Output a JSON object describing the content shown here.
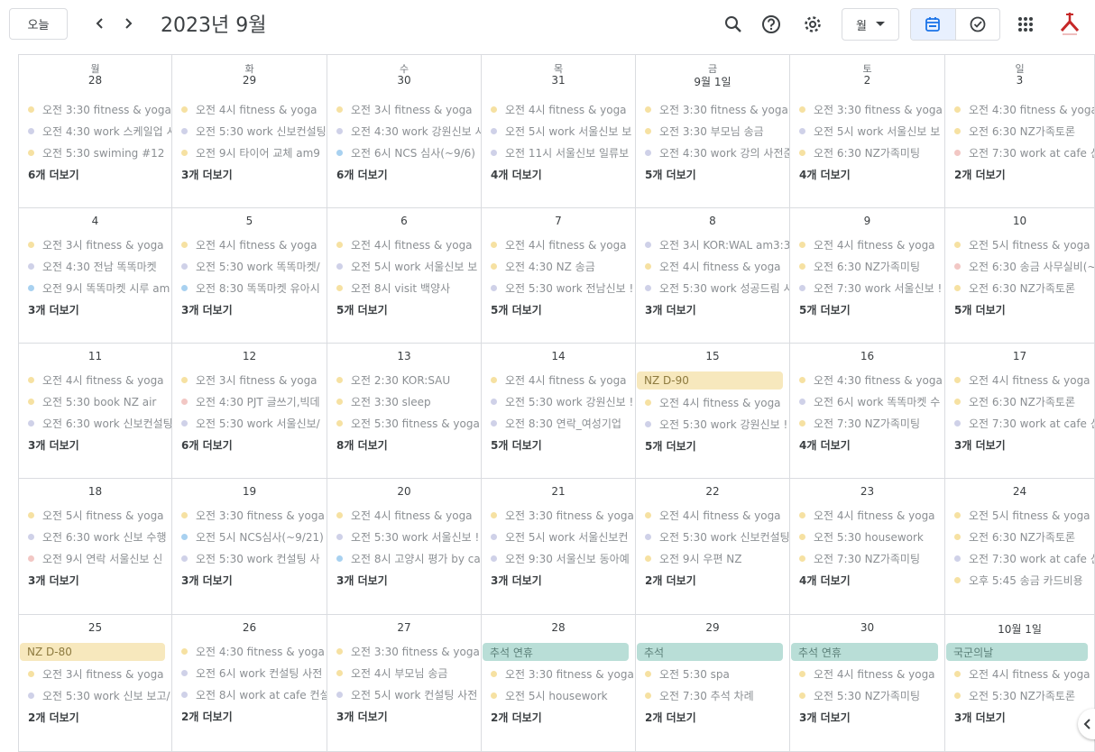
{
  "header": {
    "today_label": "오늘",
    "title": "2023년 9월",
    "view_label": "월"
  },
  "icons": [
    "chevron-left-icon",
    "chevron-right-icon",
    "search-icon",
    "help-icon",
    "gear-icon",
    "dropdown-arrow-icon",
    "calendar-icon",
    "tasks-icon",
    "apps-grid-icon",
    "logo"
  ],
  "colors": {
    "yellow": "#f6e1a2",
    "lavender": "#cfd1e8",
    "blue": "#a8d1f0",
    "pink": "#f2c7c4",
    "holiday": "#b9ded7",
    "nz_banner": "#f7e8bd"
  },
  "weekdays": [
    "월",
    "화",
    "수",
    "목",
    "금",
    "토",
    "일"
  ],
  "weeks": [
    [
      {
        "day": "28",
        "events": [
          {
            "t": "오전 3:30 fitness & yoga",
            "c": "yellow"
          },
          {
            "t": "오전 4:30 work 스케일업 시",
            "c": "lavender"
          },
          {
            "t": "오전 5:30 swiming #12",
            "c": "yellow"
          }
        ],
        "more": "6개 더보기"
      },
      {
        "day": "29",
        "events": [
          {
            "t": "오전 4시 fitness & yoga",
            "c": "yellow"
          },
          {
            "t": "오전 5:30 work 신보컨설팅",
            "c": "lavender"
          },
          {
            "t": "오전 9시 타이어 교체 am9",
            "c": "yellow"
          }
        ],
        "more": "3개 더보기"
      },
      {
        "day": "30",
        "events": [
          {
            "t": "오전 3시 fitness & yoga",
            "c": "yellow"
          },
          {
            "t": "오전 4:30 work 강원신보 시",
            "c": "lavender"
          },
          {
            "t": "오전 6시 NCS 심사(~9/6)",
            "c": "blue"
          }
        ],
        "more": "6개 더보기"
      },
      {
        "day": "31",
        "events": [
          {
            "t": "오전 4시 fitness & yoga",
            "c": "yellow"
          },
          {
            "t": "오전 5시 work 서울신보 보",
            "c": "lavender"
          },
          {
            "t": "오전 11시 서울신보 일류보",
            "c": "lavender"
          }
        ],
        "more": "4개 더보기"
      },
      {
        "day": "9월 1일",
        "events": [
          {
            "t": "오전 3:30 fitness & yoga",
            "c": "yellow"
          },
          {
            "t": "오전 3:30 부모님 송금",
            "c": "yellow"
          },
          {
            "t": "오전 4:30 work 강의 사전준",
            "c": "lavender"
          }
        ],
        "more": "5개 더보기"
      },
      {
        "day": "2",
        "events": [
          {
            "t": "오전 3:30 fitness & yoga",
            "c": "yellow"
          },
          {
            "t": "오전 5시 work 서울신보 보",
            "c": "lavender"
          },
          {
            "t": "오전 6:30 NZ가족미팅",
            "c": "yellow"
          }
        ],
        "more": "4개 더보기"
      },
      {
        "day": "3",
        "events": [
          {
            "t": "오전 4:30 fitness & yoga",
            "c": "yellow"
          },
          {
            "t": "오전 6:30 NZ가족토론",
            "c": "yellow"
          },
          {
            "t": "오전 7:30 work at cafe 신",
            "c": "pink"
          }
        ],
        "more": "2개 더보기"
      }
    ],
    [
      {
        "day": "4",
        "events": [
          {
            "t": "오전 3시 fitness & yoga",
            "c": "yellow"
          },
          {
            "t": "오전 4:30 전남 똑똑마켓",
            "c": "lavender"
          },
          {
            "t": "오전 9시 똑똑마켓 시루 am",
            "c": "blue"
          }
        ],
        "more": "3개 더보기"
      },
      {
        "day": "5",
        "events": [
          {
            "t": "오전 4시 fitness & yoga",
            "c": "yellow"
          },
          {
            "t": "오전 5:30 work 똑똑마켓/",
            "c": "lavender"
          },
          {
            "t": "오전 8:30 똑똑마켓 유아시",
            "c": "blue"
          }
        ],
        "more": "3개 더보기"
      },
      {
        "day": "6",
        "events": [
          {
            "t": "오전 4시 fitness & yoga",
            "c": "yellow"
          },
          {
            "t": "오전 5시 work 서울신보 보",
            "c": "lavender"
          },
          {
            "t": "오전 8시 visit 백양사",
            "c": "yellow"
          }
        ],
        "more": "5개 더보기"
      },
      {
        "day": "7",
        "events": [
          {
            "t": "오전 4시 fitness & yoga",
            "c": "yellow"
          },
          {
            "t": "오전 4:30 NZ 송금",
            "c": "yellow"
          },
          {
            "t": "오전 5:30 work 전남신보 !",
            "c": "lavender"
          }
        ],
        "more": "5개 더보기"
      },
      {
        "day": "8",
        "events": [
          {
            "t": "오전 3시 KOR:WAL am3:3",
            "c": "lavender"
          },
          {
            "t": "오전 4시 fitness & yoga",
            "c": "yellow"
          },
          {
            "t": "오전 5:30 work 성공드림 시",
            "c": "lavender"
          }
        ],
        "more": "3개 더보기"
      },
      {
        "day": "9",
        "events": [
          {
            "t": "오전 4시 fitness & yoga",
            "c": "yellow"
          },
          {
            "t": "오전 6:30 NZ가족미팅",
            "c": "yellow"
          },
          {
            "t": "오전 7:30 work 서울신보 !",
            "c": "lavender"
          }
        ],
        "more": "5개 더보기"
      },
      {
        "day": "10",
        "events": [
          {
            "t": "오전 5시 fitness & yoga",
            "c": "yellow"
          },
          {
            "t": "오전 6:30 송금 사무실비(~",
            "c": "pink"
          },
          {
            "t": "오전 6:30 NZ가족토론",
            "c": "yellow"
          }
        ],
        "more": "5개 더보기"
      }
    ],
    [
      {
        "day": "11",
        "events": [
          {
            "t": "오전 4시 fitness & yoga",
            "c": "yellow"
          },
          {
            "t": "오전 5:30 book NZ air",
            "c": "yellow"
          },
          {
            "t": "오전 6:30 work 신보컨설팅",
            "c": "lavender"
          }
        ],
        "more": "3개 더보기"
      },
      {
        "day": "12",
        "events": [
          {
            "t": "오전 3시 fitness & yoga",
            "c": "yellow"
          },
          {
            "t": "오전 4:30 PJT 글쓰기,빅데",
            "c": "pink"
          },
          {
            "t": "오전 5:30 work 서울신보/",
            "c": "lavender"
          }
        ],
        "more": "6개 더보기"
      },
      {
        "day": "13",
        "events": [
          {
            "t": "오전 2:30 KOR:SAU",
            "c": "yellow"
          },
          {
            "t": "오전 3:30 sleep",
            "c": "yellow"
          },
          {
            "t": "오전 5:30 fitness & yoga",
            "c": "yellow"
          }
        ],
        "more": "8개 더보기"
      },
      {
        "day": "14",
        "events": [
          {
            "t": "오전 4시 fitness & yoga",
            "c": "yellow"
          },
          {
            "t": "오전 5:30 work 강원신보 !",
            "c": "lavender"
          },
          {
            "t": "오전 8:30 연락_여성기업",
            "c": "lavender"
          }
        ],
        "more": "5개 더보기"
      },
      {
        "day": "15",
        "banner": {
          "t": "NZ D-90",
          "c": "nz_banner"
        },
        "events": [
          {
            "t": "오전 4시 fitness & yoga",
            "c": "yellow"
          },
          {
            "t": "오전 5:30 work 강원신보 !",
            "c": "lavender"
          }
        ],
        "more": "5개 더보기"
      },
      {
        "day": "16",
        "events": [
          {
            "t": "오전 4:30 fitness & yoga",
            "c": "yellow"
          },
          {
            "t": "오전 6시 work 똑똑마켓 수",
            "c": "lavender"
          },
          {
            "t": "오전 7:30 NZ가족미팅",
            "c": "yellow"
          }
        ],
        "more": "4개 더보기"
      },
      {
        "day": "17",
        "events": [
          {
            "t": "오전 4시 fitness & yoga",
            "c": "yellow"
          },
          {
            "t": "오전 6:30 NZ가족토론",
            "c": "yellow"
          },
          {
            "t": "오전 7:30 work at cafe 신",
            "c": "lavender"
          }
        ],
        "more": "3개 더보기"
      }
    ],
    [
      {
        "day": "18",
        "events": [
          {
            "t": "오전 5시 fitness & yoga",
            "c": "yellow"
          },
          {
            "t": "오전 6:30 work 신보 수행",
            "c": "lavender"
          },
          {
            "t": "오전 9시 연락 서울신보 신",
            "c": "pink"
          }
        ],
        "more": "3개 더보기"
      },
      {
        "day": "19",
        "events": [
          {
            "t": "오전 3:30 fitness & yoga",
            "c": "yellow"
          },
          {
            "t": "오전 5시 NCS심사(~9/21)",
            "c": "blue"
          },
          {
            "t": "오전 5:30 work 컨설팅 사",
            "c": "lavender"
          }
        ],
        "more": "3개 더보기"
      },
      {
        "day": "20",
        "events": [
          {
            "t": "오전 4시 fitness & yoga",
            "c": "yellow"
          },
          {
            "t": "오전 5:30 work 서울신보 !",
            "c": "lavender"
          },
          {
            "t": "오전 8시 고양시 평가 by ca",
            "c": "blue"
          }
        ],
        "more": "3개 더보기"
      },
      {
        "day": "21",
        "events": [
          {
            "t": "오전 3:30 fitness & yoga",
            "c": "yellow"
          },
          {
            "t": "오전 5시 work 서울신보컨",
            "c": "lavender"
          },
          {
            "t": "오전 9:30 서울신보 동아예",
            "c": "lavender"
          }
        ],
        "more": "3개 더보기"
      },
      {
        "day": "22",
        "events": [
          {
            "t": "오전 4시 fitness & yoga",
            "c": "yellow"
          },
          {
            "t": "오전 5:30 work 신보컨설팅",
            "c": "lavender"
          },
          {
            "t": "오전 9시 우편 NZ",
            "c": "yellow"
          }
        ],
        "more": "2개 더보기"
      },
      {
        "day": "23",
        "events": [
          {
            "t": "오전 4시 fitness & yoga",
            "c": "yellow"
          },
          {
            "t": "오전 5:30 housework",
            "c": "yellow"
          },
          {
            "t": "오전 7:30 NZ가족미팅",
            "c": "yellow"
          }
        ],
        "more": "4개 더보기"
      },
      {
        "day": "24",
        "events": [
          {
            "t": "오전 5시 fitness & yoga",
            "c": "yellow"
          },
          {
            "t": "오전 6:30 NZ가족토론",
            "c": "yellow"
          },
          {
            "t": "오전 7:30 work at cafe 신",
            "c": "lavender"
          },
          {
            "t": "오후 5:45 송금 카드비용",
            "c": "yellow"
          }
        ],
        "more": ""
      }
    ],
    [
      {
        "day": "25",
        "banner": {
          "t": "NZ D-80",
          "c": "nz_banner"
        },
        "events": [
          {
            "t": "오전 3시 fitness & yoga",
            "c": "yellow"
          },
          {
            "t": "오전 5:30 work 신보 보고/",
            "c": "lavender"
          }
        ],
        "more": "2개 더보기"
      },
      {
        "day": "26",
        "events": [
          {
            "t": "오전 4:30 fitness & yoga",
            "c": "yellow"
          },
          {
            "t": "오전 6시 work 컨설팅 사전",
            "c": "lavender"
          },
          {
            "t": "오전 8시 work at cafe 컨설",
            "c": "lavender"
          }
        ],
        "more": "2개 더보기"
      },
      {
        "day": "27",
        "events": [
          {
            "t": "오전 3:30 fitness & yoga",
            "c": "yellow"
          },
          {
            "t": "오전 4시 부모님 송금",
            "c": "yellow"
          },
          {
            "t": "오전 5시 work 컨설팅 사전",
            "c": "lavender"
          }
        ],
        "more": "3개 더보기"
      },
      {
        "day": "28",
        "banner": {
          "t": "추석 연휴",
          "c": "holiday"
        },
        "events": [
          {
            "t": "오전 3:30 fitness & yoga",
            "c": "yellow"
          },
          {
            "t": "오전 5시 housework",
            "c": "yellow"
          }
        ],
        "more": "2개 더보기"
      },
      {
        "day": "29",
        "banner": {
          "t": "추석",
          "c": "holiday"
        },
        "events": [
          {
            "t": "오전 5:30 spa",
            "c": "yellow"
          },
          {
            "t": "오전 7:30 추석 차례",
            "c": "yellow"
          }
        ],
        "more": "2개 더보기"
      },
      {
        "day": "30",
        "banner": {
          "t": "추석 연휴",
          "c": "holiday"
        },
        "events": [
          {
            "t": "오전 4시 fitness & yoga",
            "c": "yellow"
          },
          {
            "t": "오전 5:30 NZ가족미팅",
            "c": "yellow"
          }
        ],
        "more": "3개 더보기"
      },
      {
        "day": "10월 1일",
        "banner": {
          "t": "국군의날",
          "c": "holiday"
        },
        "events": [
          {
            "t": "오전 4시 fitness & yoga",
            "c": "yellow"
          },
          {
            "t": "오전 5:30 NZ가족토론",
            "c": "yellow"
          }
        ],
        "more": "3개 더보기"
      }
    ]
  ]
}
